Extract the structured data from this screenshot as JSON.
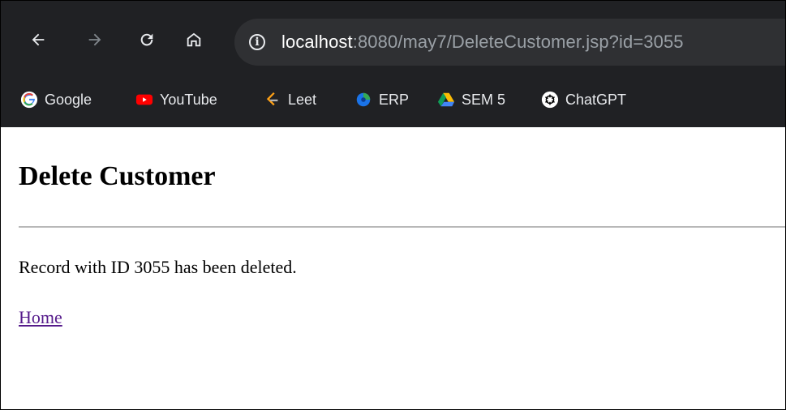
{
  "browser": {
    "url_host": "localhost",
    "url_rest": ":8080/may7/DeleteCustomer.jsp?id=3055"
  },
  "bookmarks": [
    {
      "label": "Google",
      "icon": "google-icon"
    },
    {
      "label": "YouTube",
      "icon": "youtube-icon"
    },
    {
      "label": "Leet",
      "icon": "leetcode-icon"
    },
    {
      "label": "ERP",
      "icon": "erp-icon"
    },
    {
      "label": "SEM 5",
      "icon": "google-drive-icon"
    },
    {
      "label": "ChatGPT",
      "icon": "chatgpt-icon"
    }
  ],
  "page": {
    "title": "Delete Customer",
    "message": "Record with ID 3055 has been deleted.",
    "home_link": "Home"
  },
  "colors": {
    "chrome_bg": "#202124",
    "omnibox_bg": "#2f3033",
    "visited_link": "#551a8b"
  }
}
